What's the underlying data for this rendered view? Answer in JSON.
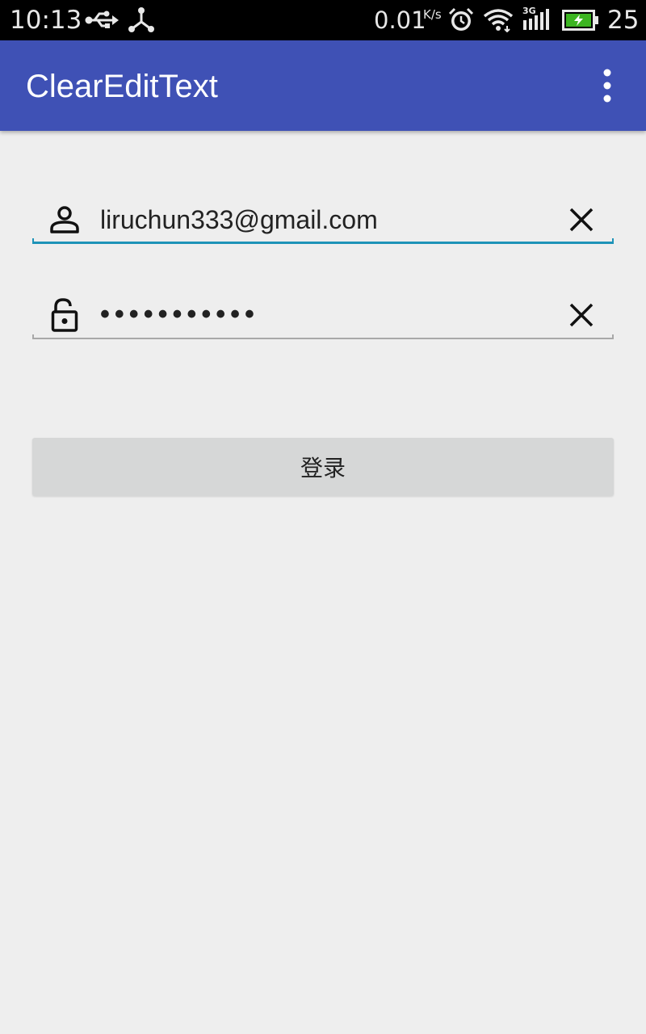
{
  "status_bar": {
    "time": "10:13",
    "net_speed": "0.01",
    "net_speed_unit": "K/s",
    "signal_label": "3G",
    "battery_level": "25",
    "icons": [
      "usb-icon",
      "share-icon",
      "alarm-icon",
      "wifi-icon",
      "signal-icon",
      "battery-icon"
    ],
    "battery_color": "#3cb521"
  },
  "app_bar": {
    "title": "ClearEditText",
    "background": "#3f51b5",
    "overflow_icon": "more-vert-icon"
  },
  "form": {
    "email": {
      "icon": "person-icon",
      "value": "liruchun333@gmail.com",
      "clear_icon": "close-icon",
      "focused": true,
      "accent": "#1e93b8"
    },
    "password": {
      "icon": "unlock-icon",
      "value": "•••••••••••",
      "clear_icon": "close-icon",
      "focused": false
    },
    "login_label": "登录"
  }
}
